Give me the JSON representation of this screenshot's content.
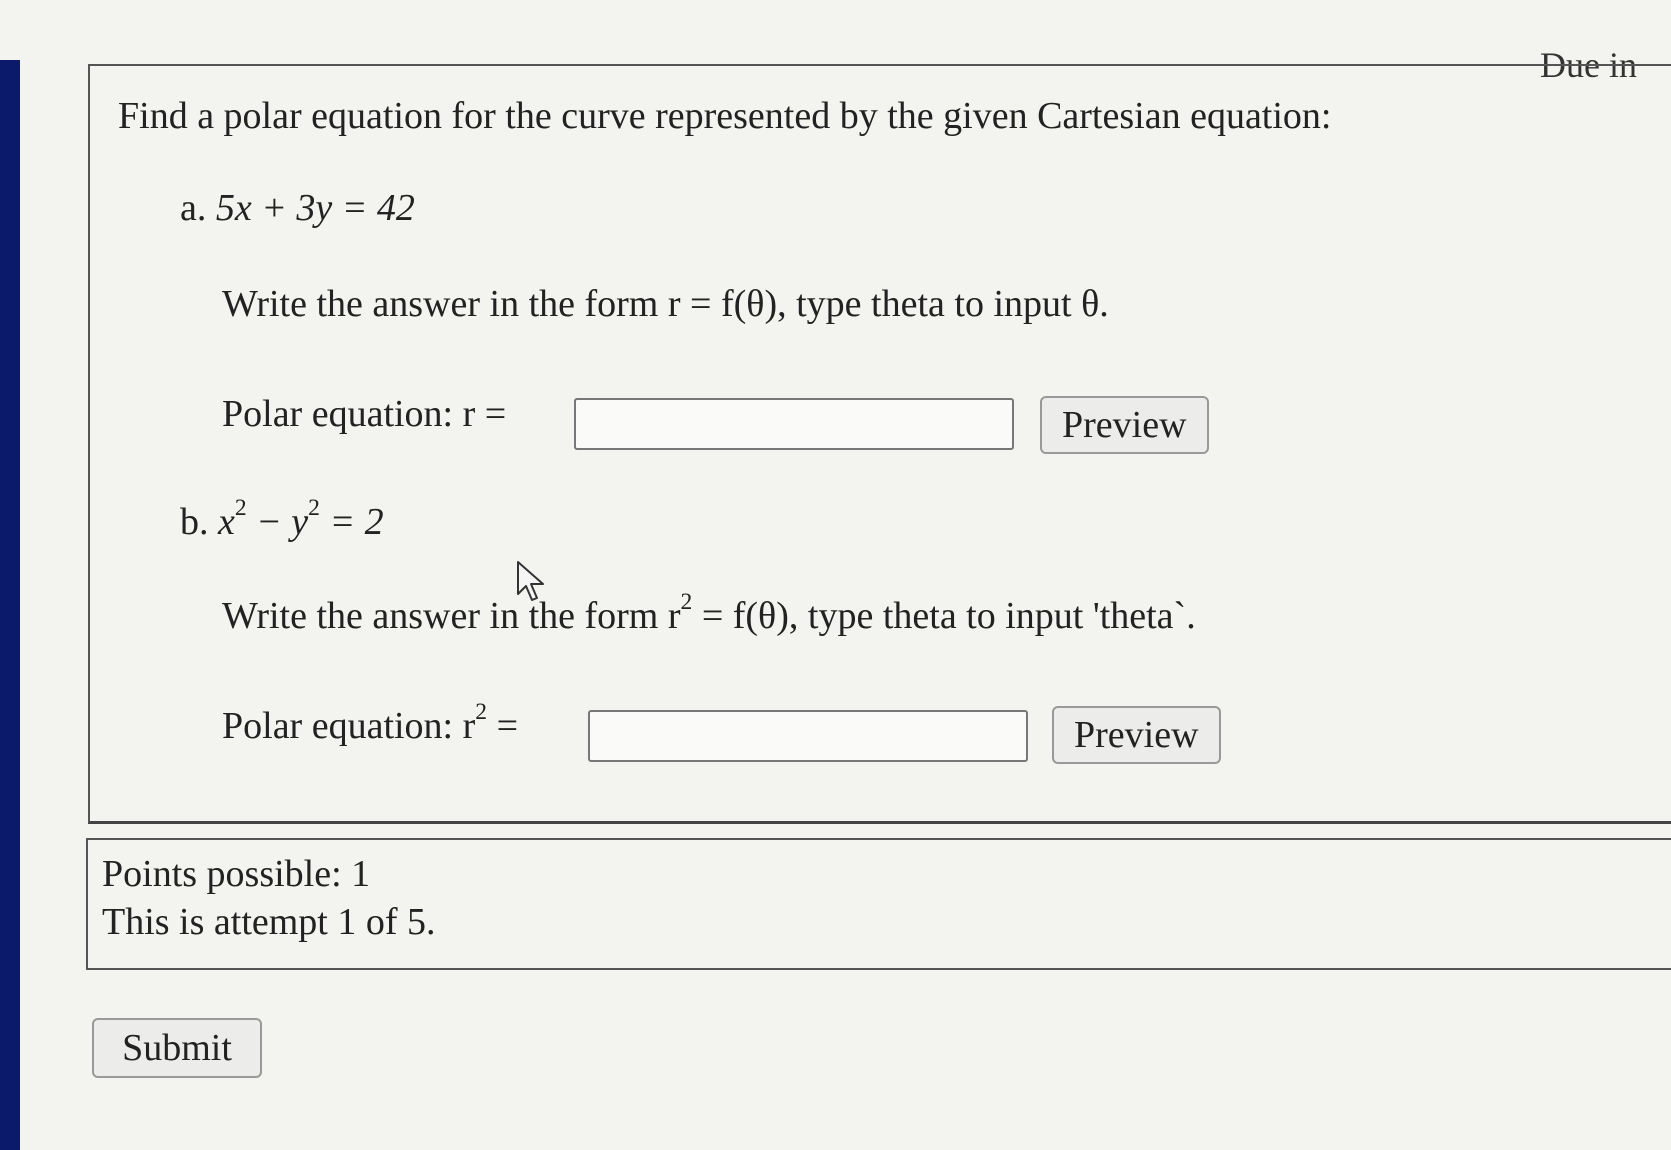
{
  "header": {
    "due_text": "Due in"
  },
  "question": {
    "prompt": "Find a polar equation for the curve represented by the given Cartesian equation:",
    "part_a": {
      "label": "a.",
      "equation": "5x + 3y = 42",
      "instruction": "Write the answer in the form r = f(θ), type theta to input θ.",
      "answer_label": "Polar equation: r =",
      "answer_value": "",
      "preview_label": "Preview"
    },
    "part_b": {
      "label": "b.",
      "equation_base": "x",
      "instruction_pre": "Write the answer in the form r",
      "instruction_post": " = f(θ), type theta to input 'theta`.",
      "answer_label_pre": "Polar equation: r",
      "answer_label_post": " =",
      "answer_value": "",
      "preview_label": "Preview"
    }
  },
  "info": {
    "points": "Points possible: 1",
    "attempt": "This is attempt 1 of 5."
  },
  "actions": {
    "submit_label": "Submit"
  },
  "colors": {
    "background": "#f3f3ef",
    "left_edge": "#0b1a6b",
    "border": "#555555",
    "button_bg": "#ececea"
  }
}
